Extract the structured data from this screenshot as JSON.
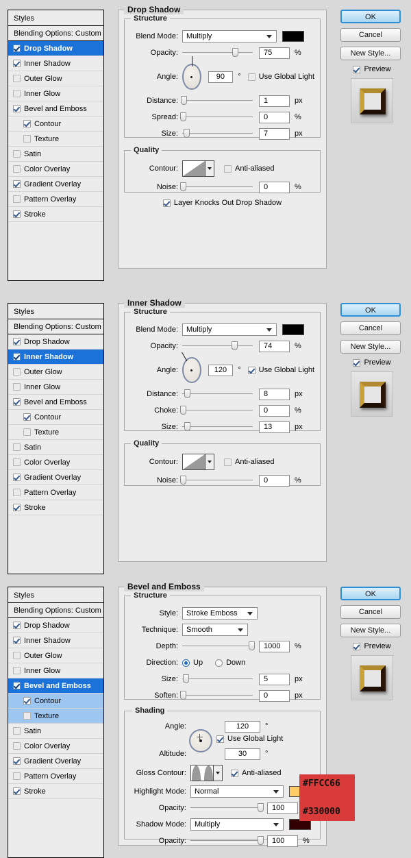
{
  "common": {
    "styles_header": "Styles",
    "blending_options": "Blending Options: Custom",
    "style_items": [
      {
        "label": "Drop Shadow",
        "checked": true
      },
      {
        "label": "Inner Shadow",
        "checked": true
      },
      {
        "label": "Outer Glow",
        "checked": false
      },
      {
        "label": "Inner Glow",
        "checked": false
      },
      {
        "label": "Bevel and Emboss",
        "checked": true
      },
      {
        "label": "Contour",
        "checked": true
      },
      {
        "label": "Texture",
        "checked": false
      },
      {
        "label": "Satin",
        "checked": false
      },
      {
        "label": "Color Overlay",
        "checked": false
      },
      {
        "label": "Gradient Overlay",
        "checked": true
      },
      {
        "label": "Pattern Overlay",
        "checked": false
      },
      {
        "label": "Stroke",
        "checked": true
      }
    ],
    "buttons": {
      "ok": "OK",
      "cancel": "Cancel",
      "new_style": "New Style...",
      "preview": "Preview",
      "preview_checked": true
    },
    "labels": {
      "blend_mode": "Blend Mode:",
      "opacity": "Opacity:",
      "angle": "Angle:",
      "distance": "Distance:",
      "spread": "Spread:",
      "choke": "Choke:",
      "size": "Size:",
      "contour": "Contour:",
      "noise": "Noise:",
      "use_global_light": "Use Global Light",
      "anti_aliased": "Anti-aliased",
      "structure": "Structure",
      "quality": "Quality",
      "shading": "Shading",
      "style": "Style:",
      "technique": "Technique:",
      "depth": "Depth:",
      "direction": "Direction:",
      "soften": "Soften:",
      "altitude": "Altitude:",
      "gloss_contour": "Gloss Contour:",
      "highlight_mode": "Highlight Mode:",
      "shadow_mode": "Shadow Mode:",
      "up": "Up",
      "down": "Down",
      "unit_px": "px",
      "unit_pct": "%",
      "unit_deg": "°"
    }
  },
  "panel1": {
    "title": "Drop Shadow",
    "selected_style": "Drop Shadow",
    "blend_mode": "Multiply",
    "blend_color": "#000000",
    "opacity": "75",
    "angle": "90",
    "use_global_light": false,
    "distance": "1",
    "spread": "0",
    "size": "7",
    "anti_aliased": false,
    "noise": "0",
    "knockout_label": "Layer Knocks Out Drop Shadow",
    "knockout_checked": true
  },
  "panel2": {
    "title": "Inner Shadow",
    "selected_style": "Inner Shadow",
    "blend_mode": "Multiply",
    "blend_color": "#000000",
    "opacity": "74",
    "angle": "120",
    "use_global_light": true,
    "distance": "8",
    "choke": "0",
    "size": "13",
    "anti_aliased": false,
    "noise": "0"
  },
  "panel3": {
    "title": "Bevel and Emboss",
    "selected_style": "Bevel and Emboss",
    "style": "Stroke Emboss",
    "technique": "Smooth",
    "depth": "1000",
    "direction": "Up",
    "size": "5",
    "soften": "0",
    "angle": "120",
    "use_global_light": true,
    "altitude": "30",
    "anti_aliased": true,
    "highlight_mode": "Normal",
    "highlight_color": "#FFCC66",
    "highlight_opacity": "100",
    "shadow_mode": "Multiply",
    "shadow_color": "#330000",
    "shadow_opacity": "100",
    "annotation": {
      "background": "#d93b3b",
      "highlight_hex": "#FFCC66",
      "shadow_hex": "#330000"
    }
  }
}
